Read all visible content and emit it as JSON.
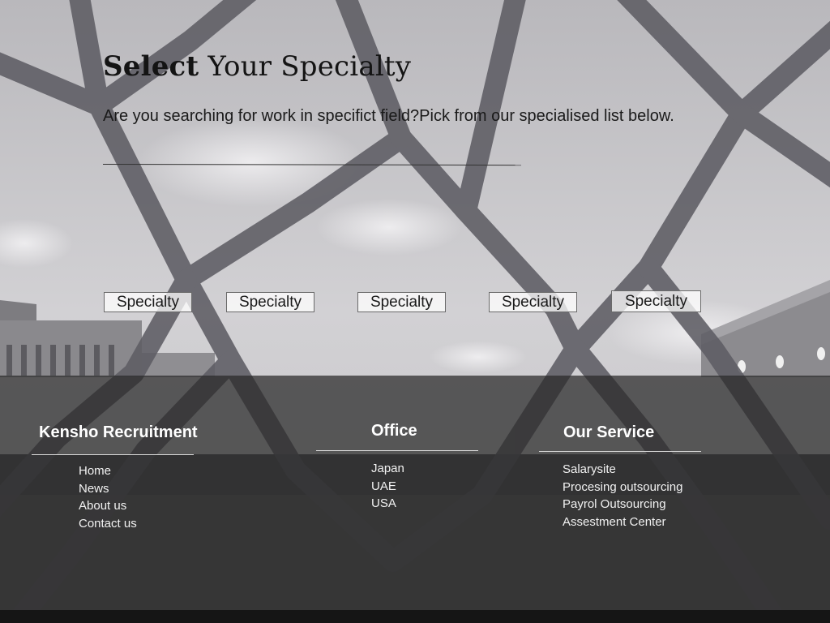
{
  "hero": {
    "title_bold": "Select",
    "title_rest": " Your Specialty",
    "subtitle": "Are you searching for work in specifict field?Pick from our specialised list below."
  },
  "specialties": [
    "Specialty",
    "Specialty",
    "Specialty",
    "Specialty",
    "Specialty"
  ],
  "footer": {
    "company": {
      "heading": "Kensho Recruitment",
      "links": [
        "Home",
        "News",
        "About us",
        "Contact us"
      ]
    },
    "office": {
      "heading": "Office",
      "items": [
        "Japan",
        "UAE",
        "USA"
      ]
    },
    "service": {
      "heading": "Our Service",
      "items": [
        "Salarysite",
        "Procesing outsourcing",
        "Payrol Outsourcing",
        "Assestment Center"
      ]
    }
  },
  "colors": {
    "sky": "#c9c8cb",
    "fence": "#5e5d64",
    "footer_overlay": "#282828",
    "bottom_bar": "#151515"
  }
}
